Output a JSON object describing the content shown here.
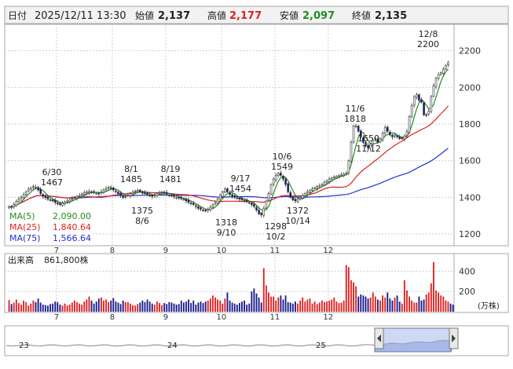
{
  "header": {
    "date_label": "日付",
    "datetime": "2025/12/11 13:30",
    "open_label": "始値",
    "open": "2,137",
    "high_label": "高値",
    "high": "2,177",
    "low_label": "安値",
    "low": "2,097",
    "close_label": "終値",
    "close": "2,135"
  },
  "colors": {
    "up": "#ffffff",
    "down": "#1a1a8c",
    "candle_border": "#333333",
    "ma5": "#228b22",
    "ma25": "#e02020",
    "ma75": "#2030d0",
    "high_value": "#e02020",
    "low_value": "#228b22",
    "vol_up": "#e02020",
    "vol_down": "#1a1a8c",
    "mini_fill": "#a8b8e8"
  },
  "chart_data": [
    {
      "type": "candlestick",
      "title": "",
      "ylim": [
        1140,
        2340
      ],
      "yticks": [
        1200,
        1400,
        1600,
        1800,
        2000,
        2200
      ],
      "month_ticks": [
        "7",
        "8",
        "9",
        "10",
        "11",
        "12"
      ],
      "legend": [
        {
          "label": "MA(5)",
          "value": "2,090.00"
        },
        {
          "label": "MA(25)",
          "value": "1,840.64"
        },
        {
          "label": "MA(75)",
          "value": "1,566.64"
        }
      ],
      "annotations": [
        {
          "date": "6/30",
          "price": "1467"
        },
        {
          "date": "8/1",
          "price": "1485"
        },
        {
          "date": "8/19",
          "price": "1481"
        },
        {
          "date": "8/6",
          "price": "1375"
        },
        {
          "date": "9/17",
          "price": "1454"
        },
        {
          "date": "9/10",
          "price": "1318"
        },
        {
          "date": "10/6",
          "price": "1549"
        },
        {
          "date": "10/2",
          "price": "1298"
        },
        {
          "date": "10/14",
          "price": "1372"
        },
        {
          "date": "11/6",
          "price": "1818"
        },
        {
          "date": "11/12",
          "price": "1650"
        },
        {
          "date": "12/8",
          "price": "2200"
        }
      ],
      "closes": [
        1350,
        1345,
        1360,
        1378,
        1390,
        1402,
        1415,
        1430,
        1445,
        1452,
        1460,
        1455,
        1440,
        1420,
        1405,
        1398,
        1390,
        1385,
        1380,
        1372,
        1365,
        1360,
        1368,
        1375,
        1380,
        1385,
        1392,
        1398,
        1404,
        1410,
        1418,
        1425,
        1430,
        1432,
        1428,
        1425,
        1422,
        1420,
        1430,
        1440,
        1448,
        1455,
        1450,
        1440,
        1430,
        1420,
        1410,
        1400,
        1405,
        1412,
        1420,
        1428,
        1435,
        1438,
        1432,
        1426,
        1420,
        1415,
        1410,
        1405,
        1412,
        1420,
        1425,
        1430,
        1424,
        1418,
        1412,
        1408,
        1404,
        1400,
        1396,
        1392,
        1388,
        1380,
        1372,
        1365,
        1360,
        1350,
        1340,
        1335,
        1330,
        1325,
        1335,
        1345,
        1358,
        1370,
        1390,
        1410,
        1430,
        1445,
        1430,
        1415,
        1405,
        1400,
        1395,
        1390,
        1386,
        1382,
        1376,
        1370,
        1360,
        1350,
        1330,
        1310,
        1305,
        1340,
        1380,
        1420,
        1470,
        1500,
        1520,
        1530,
        1520,
        1500,
        1470,
        1430,
        1400,
        1385,
        1380,
        1390,
        1400,
        1410,
        1420,
        1430,
        1438,
        1446,
        1452,
        1458,
        1462,
        1470,
        1480,
        1490,
        1500,
        1505,
        1510,
        1515,
        1518,
        1522,
        1528,
        1530,
        1600,
        1700,
        1790,
        1790,
        1760,
        1730,
        1700,
        1680,
        1670,
        1690,
        1710,
        1720,
        1700,
        1720,
        1750,
        1780,
        1760,
        1740,
        1730,
        1740,
        1730,
        1720,
        1720,
        1735,
        1760,
        1840,
        1900,
        1950,
        1960,
        1930,
        1920,
        1850,
        1850,
        1870,
        1950,
        2010,
        2050,
        2070,
        2080,
        2100,
        2120,
        2135
      ]
    },
    {
      "type": "bar",
      "title": "出来高",
      "value_label": "861,800株",
      "unit": "(万株)",
      "ylim": [
        0,
        520
      ],
      "yticks": [
        200,
        400
      ],
      "values": [
        115,
        75,
        90,
        120,
        85,
        70,
        110,
        95,
        60,
        80,
        110,
        95,
        130,
        90,
        70,
        65,
        60,
        75,
        80,
        100,
        95,
        70,
        60,
        80,
        60,
        70,
        90,
        110,
        95,
        80,
        70,
        100,
        120,
        150,
        110,
        80,
        100,
        130,
        140,
        110,
        120,
        95,
        110,
        135,
        100,
        90,
        75,
        110,
        95,
        95,
        80,
        65,
        60,
        75,
        90,
        110,
        95,
        120,
        100,
        80,
        70,
        100,
        85,
        65,
        85,
        75,
        95,
        90,
        80,
        70,
        75,
        110,
        90,
        100,
        120,
        85,
        110,
        70,
        90,
        100,
        85,
        100,
        110,
        130,
        160,
        140,
        120,
        110,
        80,
        130,
        190,
        110,
        90,
        80,
        70,
        85,
        100,
        110,
        70,
        80,
        200,
        230,
        180,
        140,
        90,
        430,
        260,
        190,
        150,
        150,
        110,
        140,
        160,
        120,
        160,
        95,
        90,
        80,
        100,
        80,
        110,
        140,
        100,
        120,
        130,
        80,
        100,
        75,
        90,
        110,
        95,
        100,
        110,
        120,
        140,
        100,
        85,
        90,
        110,
        460,
        440,
        310,
        290,
        250,
        150,
        170,
        160,
        150,
        130,
        140,
        190,
        150,
        120,
        110,
        160,
        140,
        190,
        130,
        110,
        140,
        160,
        100,
        80,
        310,
        210,
        150,
        110,
        90,
        90,
        150,
        110,
        120,
        170,
        190,
        280,
        490,
        210,
        190,
        160,
        150,
        110,
        100,
        80,
        70
      ]
    }
  ],
  "mini_nav": {
    "year_labels": [
      "23",
      "24",
      "25"
    ]
  }
}
